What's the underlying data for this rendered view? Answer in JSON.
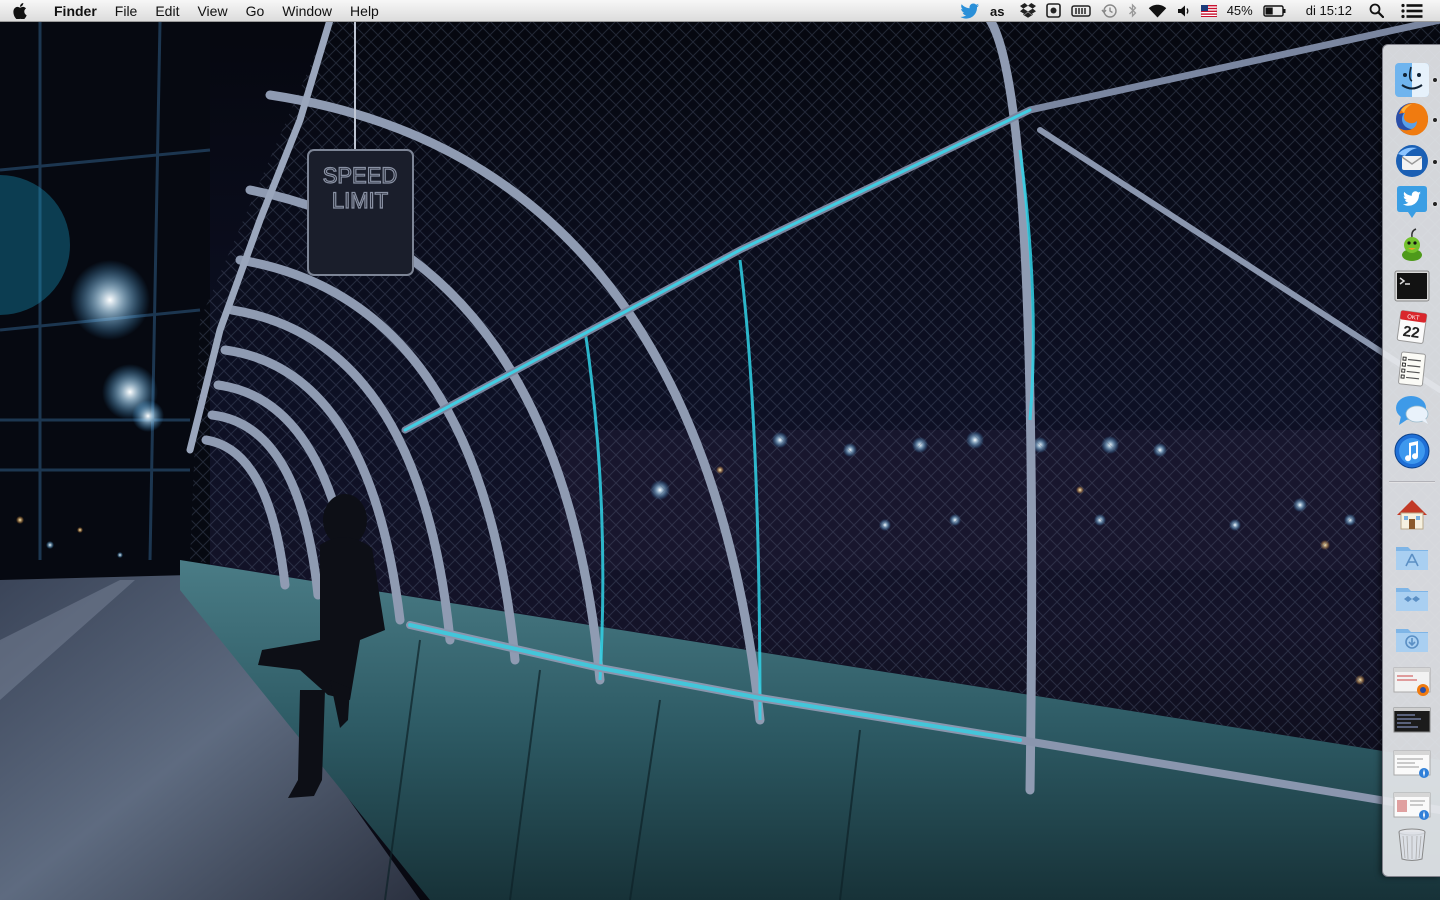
{
  "menubar": {
    "app_name": "Finder",
    "menus": [
      "File",
      "Edit",
      "View",
      "Go",
      "Window",
      "Help"
    ],
    "status": {
      "battery_percent": "45%",
      "clock": "di 15:12"
    }
  },
  "wallpaper": {
    "sign_line1": "SPEED",
    "sign_line2": "LIMIT"
  },
  "dock": {
    "apps": [
      {
        "name": "finder-icon",
        "running": true
      },
      {
        "name": "firefox-icon",
        "running": true
      },
      {
        "name": "thunderbird-icon",
        "running": true
      },
      {
        "name": "twitter-icon",
        "running": true
      },
      {
        "name": "adium-icon",
        "running": false
      },
      {
        "name": "terminal-icon",
        "running": false
      },
      {
        "name": "calendar-icon",
        "running": false
      },
      {
        "name": "notes-icon",
        "running": false
      },
      {
        "name": "messages-icon",
        "running": false
      },
      {
        "name": "itunes-icon",
        "running": false
      }
    ],
    "calendar": {
      "month": "OKT",
      "day": "22"
    },
    "stacks": [
      "home-folder-icon",
      "applications-folder-icon",
      "dropbox-folder-icon",
      "downloads-folder-icon",
      "firefox-window-icon",
      "terminal-window-icon",
      "safari-window-icon",
      "safari-window-2-icon",
      "trash-icon"
    ]
  }
}
